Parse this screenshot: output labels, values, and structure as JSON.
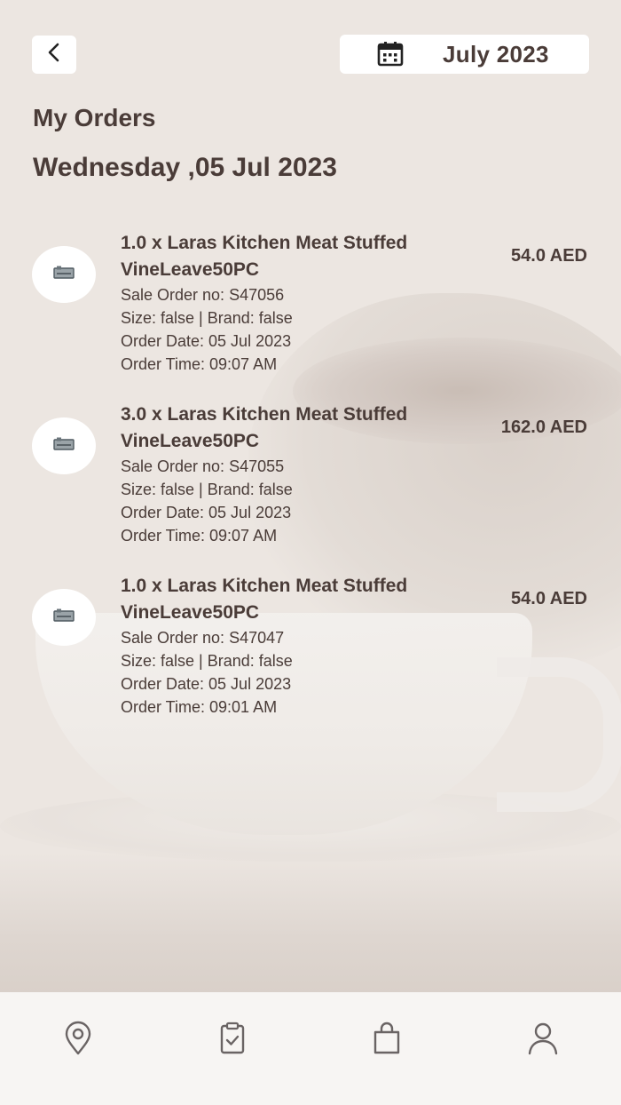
{
  "header": {
    "back_icon": "chevron-left-icon",
    "calendar_icon": "calendar-icon",
    "month_label": "July 2023"
  },
  "page": {
    "title": "My Orders",
    "day_heading": "Wednesday ,05 Jul 2023"
  },
  "orders": [
    {
      "title_line1": "1.0 x Laras Kitchen Meat Stuffed",
      "title_line2": "VineLeave50PC",
      "price": "54.0 AED",
      "sale_order": "Sale Order no: S47056",
      "size_brand": "Size: false | Brand: false",
      "order_date": "Order Date: 05 Jul 2023",
      "order_time": "Order Time: 09:07 AM"
    },
    {
      "title_line1": "3.0 x Laras Kitchen Meat Stuffed",
      "title_line2": "VineLeave50PC",
      "price": "162.0 AED",
      "sale_order": "Sale Order no: S47055",
      "size_brand": "Size: false | Brand: false",
      "order_date": "Order Date: 05 Jul 2023",
      "order_time": "Order Time: 09:07 AM"
    },
    {
      "title_line1": "1.0 x Laras Kitchen Meat Stuffed",
      "title_line2": "VineLeave50PC",
      "price": "54.0 AED",
      "sale_order": "Sale Order no: S47047",
      "size_brand": "Size: false | Brand: false",
      "order_date": "Order Date: 05 Jul 2023",
      "order_time": "Order Time: 09:01 AM"
    }
  ],
  "bottom_nav": {
    "items": [
      {
        "icon": "location-pin-icon"
      },
      {
        "icon": "clipboard-check-icon"
      },
      {
        "icon": "shopping-bag-icon"
      },
      {
        "icon": "user-profile-icon"
      }
    ]
  },
  "colors": {
    "text": "#4a3c38",
    "background": "#ece6e1",
    "card": "#ffffff",
    "nav_background": "#f7f5f3"
  }
}
